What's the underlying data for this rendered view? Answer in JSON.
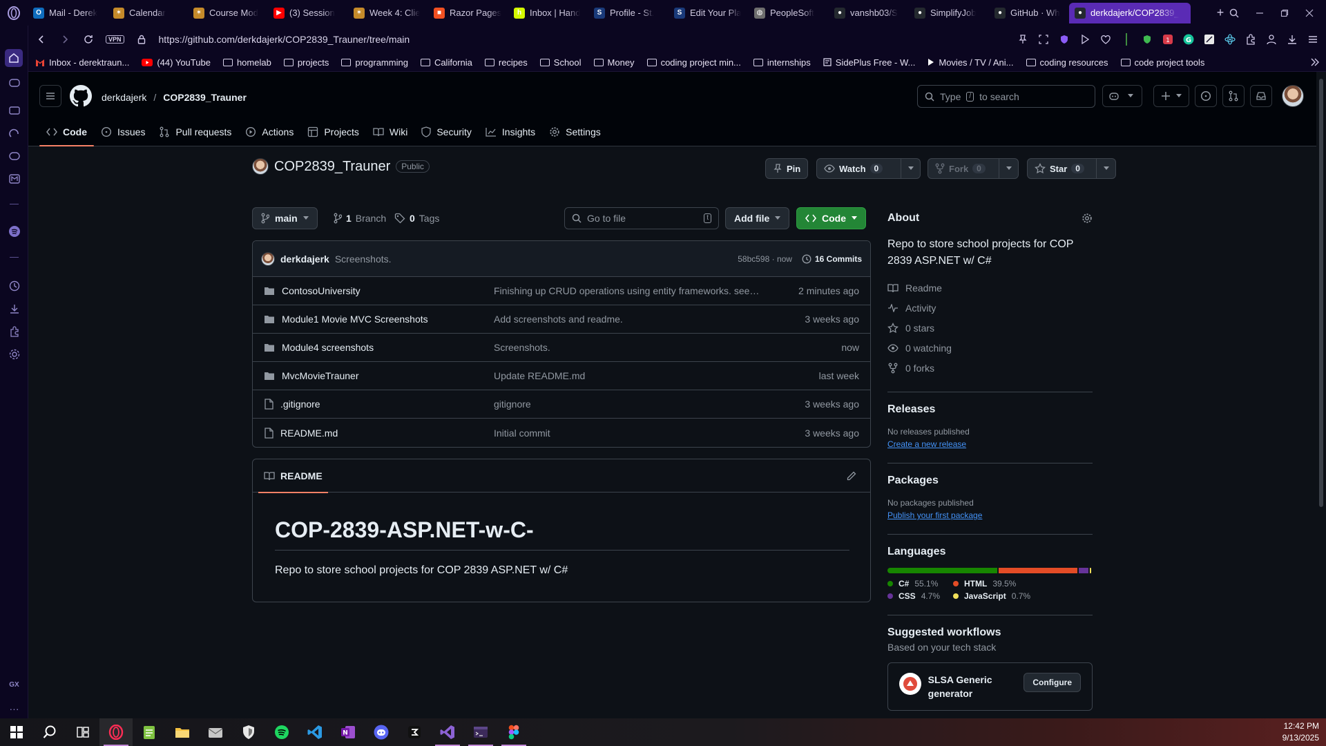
{
  "browser": {
    "tabs": [
      {
        "label": "Mail - Derek",
        "fav": "outlook",
        "color": "#0f6cbd"
      },
      {
        "label": "Calendar",
        "fav": "canvas",
        "color": "#c58a2a"
      },
      {
        "label": "Course Mod",
        "fav": "canvas",
        "color": "#c58a2a"
      },
      {
        "label": "(3) Session",
        "fav": "youtube",
        "color": "#ff0000"
      },
      {
        "label": "Week 4: Clie",
        "fav": "canvas",
        "color": "#c58a2a"
      },
      {
        "label": "Razor Pages",
        "fav": "microsoft",
        "color": "#f25022"
      },
      {
        "label": "Inbox | Hand",
        "fav": "handshake",
        "color": "#d4f700"
      },
      {
        "label": "Profile - St.",
        "fav": "spc",
        "color": "#1a3a7a"
      },
      {
        "label": "Edit Your Pla",
        "fav": "spc",
        "color": "#1a3a7a"
      },
      {
        "label": "PeopleSoft",
        "fav": "globe",
        "color": "#6e6e6e"
      },
      {
        "label": "vanshb03/S",
        "fav": "github",
        "color": "#24292f"
      },
      {
        "label": "SimplifyJob",
        "fav": "github",
        "color": "#24292f"
      },
      {
        "label": "GitHub · Wh",
        "fav": "github",
        "color": "#24292f"
      },
      {
        "label": "derkdajerk/COP2839_",
        "fav": "github",
        "color": "#24292f",
        "active": true
      }
    ],
    "url": "https://github.com/derkdajerk/COP2839_Trauner/tree/main",
    "vpn_label": "VPN",
    "bookmarks": [
      {
        "label": "Inbox - derektraun...",
        "type": "gmail"
      },
      {
        "label": "(44) YouTube",
        "type": "youtube"
      },
      {
        "label": "homelab",
        "type": "folder"
      },
      {
        "label": "projects",
        "type": "folder"
      },
      {
        "label": "programming",
        "type": "folder"
      },
      {
        "label": "California",
        "type": "folder"
      },
      {
        "label": "recipes",
        "type": "folder"
      },
      {
        "label": "School",
        "type": "folder"
      },
      {
        "label": "Money",
        "type": "folder"
      },
      {
        "label": "coding project min...",
        "type": "folder"
      },
      {
        "label": "internships",
        "type": "folder"
      },
      {
        "label": "SidePlus Free - W...",
        "type": "site"
      },
      {
        "label": "Movies / TV / Ani...",
        "type": "play"
      },
      {
        "label": "coding resources",
        "type": "folder"
      },
      {
        "label": "code project tools",
        "type": "folder"
      }
    ]
  },
  "header": {
    "owner": "derkdajerk",
    "separator": "/",
    "repo": "COP2839_Trauner",
    "search_type": "Type",
    "search_key": "/",
    "search_suffix": "to search"
  },
  "repo_nav": [
    {
      "label": "Code",
      "icon": "code-icon",
      "active": true
    },
    {
      "label": "Issues",
      "icon": "issue-icon"
    },
    {
      "label": "Pull requests",
      "icon": "pull-request-icon"
    },
    {
      "label": "Actions",
      "icon": "actions-icon"
    },
    {
      "label": "Projects",
      "icon": "projects-icon"
    },
    {
      "label": "Wiki",
      "icon": "book-icon"
    },
    {
      "label": "Security",
      "icon": "shield-icon"
    },
    {
      "label": "Insights",
      "icon": "graph-icon"
    },
    {
      "label": "Settings",
      "icon": "gear-icon"
    }
  ],
  "repo": {
    "name": "COP2839_Trauner",
    "visibility": "Public",
    "pin": "Pin",
    "watch": "Watch",
    "watch_count": "0",
    "fork": "Fork",
    "fork_count": "0",
    "star": "Star",
    "star_count": "0"
  },
  "browser_bar": {
    "branch": "main",
    "branch_count": "1",
    "branch_label": "Branch",
    "tag_count": "0",
    "tag_label": "Tags",
    "goto_placeholder": "Go to file",
    "goto_key": "t",
    "add_file": "Add file",
    "code": "Code"
  },
  "latest_commit": {
    "author": "derkdajerk",
    "message": "Screenshots.",
    "sha": "58bc598",
    "dot": "·",
    "time": "now",
    "commits": "16 Commits"
  },
  "files": [
    {
      "name": "ContosoUniversity",
      "type": "dir",
      "commit": "Finishing up CRUD operations using entity frameworks. seed...",
      "time": "2 minutes ago"
    },
    {
      "name": "Module1 Movie MVC Screenshots",
      "type": "dir",
      "commit": "Add screenshots and readme.",
      "time": "3 weeks ago"
    },
    {
      "name": "Module4 screenshots",
      "type": "dir",
      "commit": "Screenshots.",
      "time": "now"
    },
    {
      "name": "MvcMovieTrauner",
      "type": "dir",
      "commit": "Update README.md",
      "time": "last week"
    },
    {
      "name": ".gitignore",
      "type": "file",
      "commit": "gitignore",
      "time": "3 weeks ago"
    },
    {
      "name": "README.md",
      "type": "file",
      "commit": "Initial commit",
      "time": "3 weeks ago"
    }
  ],
  "readme": {
    "tab": "README",
    "heading": "COP-2839-ASP.NET-w-C-",
    "body": "Repo to store school projects for COP 2839 ASP.NET w/ C#"
  },
  "about": {
    "title": "About",
    "description": "Repo to store school projects for COP 2839 ASP.NET w/ C#",
    "items": [
      {
        "label": "Readme",
        "icon": "book-icon"
      },
      {
        "label": "Activity",
        "icon": "pulse-icon"
      },
      {
        "label": "0 stars",
        "icon": "star-icon"
      },
      {
        "label": "0 watching",
        "icon": "eye-icon"
      },
      {
        "label": "0 forks",
        "icon": "fork-icon"
      }
    ]
  },
  "releases": {
    "title": "Releases",
    "empty": "No releases published",
    "link": "Create a new release"
  },
  "packages": {
    "title": "Packages",
    "empty": "No packages published",
    "link": "Publish your first package"
  },
  "languages": {
    "title": "Languages",
    "items": [
      {
        "name": "C#",
        "percent": 55.1,
        "label": "55.1%",
        "color": "#178600"
      },
      {
        "name": "HTML",
        "percent": 39.5,
        "label": "39.5%",
        "color": "#e34c26"
      },
      {
        "name": "CSS",
        "percent": 4.7,
        "label": "4.7%",
        "color": "#663399"
      },
      {
        "name": "JavaScript",
        "percent": 0.7,
        "label": "0.7%",
        "color": "#f1e05a"
      }
    ]
  },
  "workflows": {
    "title": "Suggested workflows",
    "subtitle": "Based on your tech stack",
    "card_name": "SLSA Generic generator",
    "configure": "Configure"
  },
  "taskbar": {
    "time": "12:42 PM",
    "date": "9/13/2025"
  },
  "colors": {
    "accent_tab": "#5a2bb5",
    "code_button": "#238636",
    "underline": "#f78166",
    "link": "#4493f8"
  }
}
